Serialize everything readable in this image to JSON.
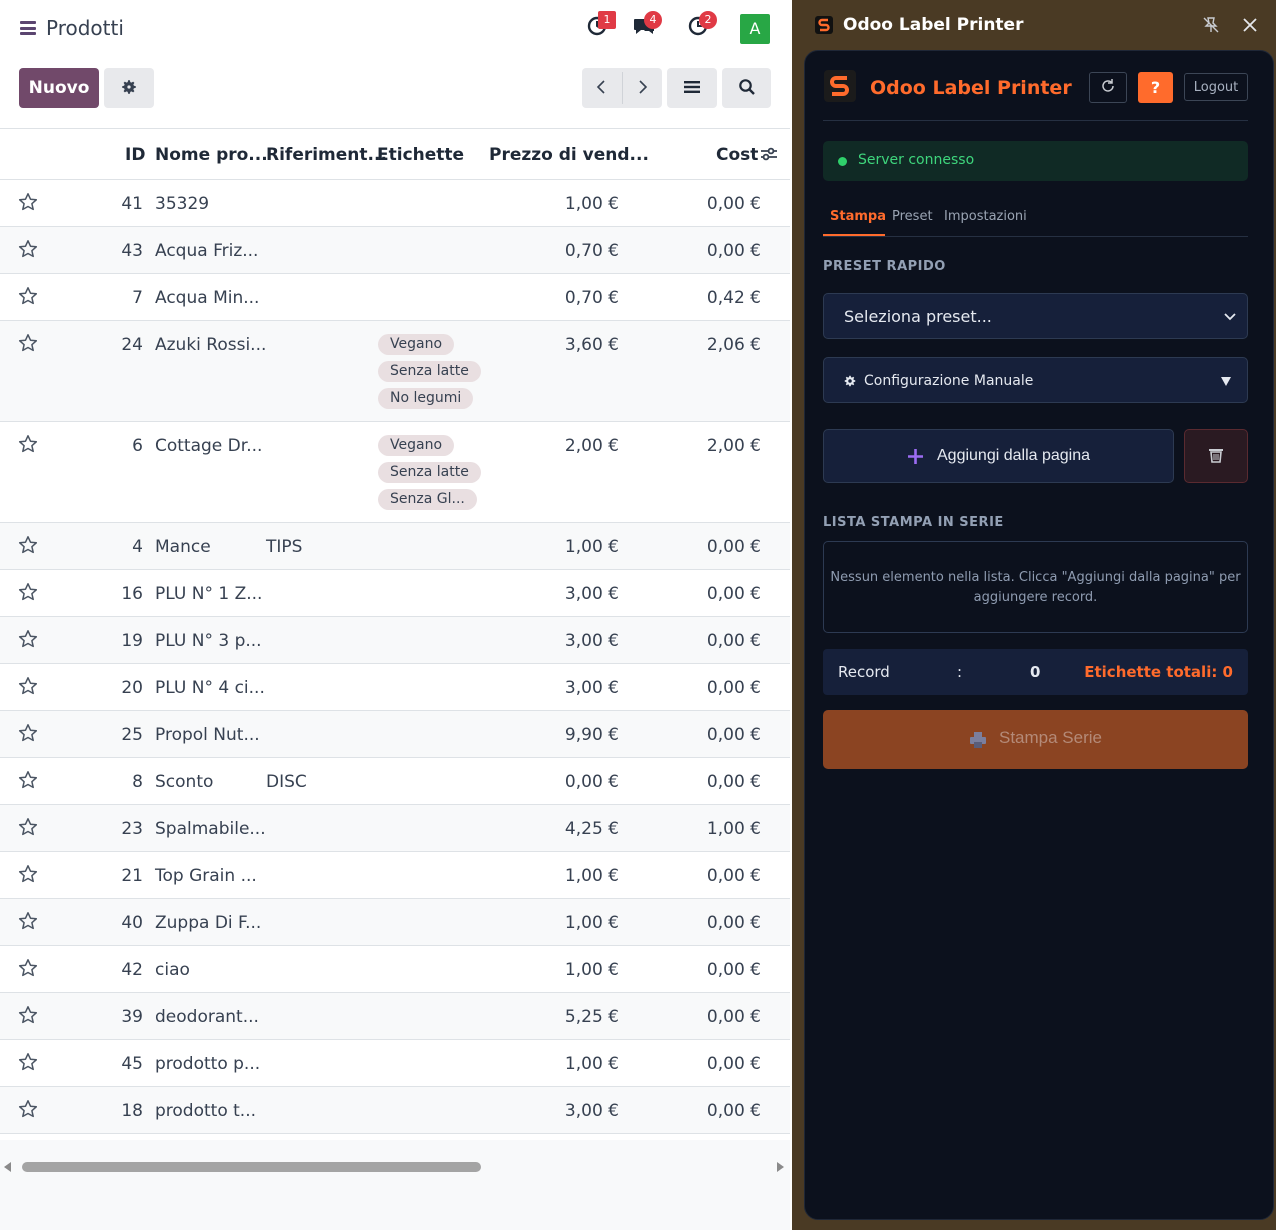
{
  "odoo": {
    "title": "Prodotti",
    "notifications": {
      "activity_count": "1",
      "messages_count": "4",
      "clock_count": "2"
    },
    "avatar_letter": "A",
    "toolbar": {
      "new_label": "Nuovo"
    },
    "columns": {
      "id": "ID",
      "name": "Nome pro...",
      "ref": "Riferiment...",
      "tags": "Etichette",
      "price": "Prezzo di vend...",
      "cost": "Cost"
    },
    "rows": [
      {
        "id": "41",
        "name": "35329",
        "ref": "",
        "tags": [],
        "price": "1,00 €",
        "cost": "0,00 €"
      },
      {
        "id": "43",
        "name": "Acqua Friz...",
        "ref": "",
        "tags": [],
        "price": "0,70 €",
        "cost": "0,00 €"
      },
      {
        "id": "7",
        "name": "Acqua Min...",
        "ref": "",
        "tags": [],
        "price": "0,70 €",
        "cost": "0,42 €"
      },
      {
        "id": "24",
        "name": "Azuki Rossi...",
        "ref": "",
        "tags": [
          "Vegano",
          "Senza latte",
          "No legumi"
        ],
        "price": "3,60 €",
        "cost": "2,06 €"
      },
      {
        "id": "6",
        "name": "Cottage Dr...",
        "ref": "",
        "tags": [
          "Vegano",
          "Senza latte",
          "Senza Gl..."
        ],
        "price": "2,00 €",
        "cost": "2,00 €"
      },
      {
        "id": "4",
        "name": "Mance",
        "ref": "TIPS",
        "tags": [],
        "price": "1,00 €",
        "cost": "0,00 €"
      },
      {
        "id": "16",
        "name": "PLU N° 1 Z...",
        "ref": "",
        "tags": [],
        "price": "3,00 €",
        "cost": "0,00 €"
      },
      {
        "id": "19",
        "name": "PLU N° 3 p...",
        "ref": "",
        "tags": [],
        "price": "3,00 €",
        "cost": "0,00 €"
      },
      {
        "id": "20",
        "name": "PLU N° 4 ci...",
        "ref": "",
        "tags": [],
        "price": "3,00 €",
        "cost": "0,00 €"
      },
      {
        "id": "25",
        "name": "Propol Nut...",
        "ref": "",
        "tags": [],
        "price": "9,90 €",
        "cost": "0,00 €"
      },
      {
        "id": "8",
        "name": "Sconto",
        "ref": "DISC",
        "tags": [],
        "price": "0,00 €",
        "cost": "0,00 €"
      },
      {
        "id": "23",
        "name": "Spalmabile...",
        "ref": "",
        "tags": [],
        "price": "4,25 €",
        "cost": "1,00 €"
      },
      {
        "id": "21",
        "name": "Top Grain ...",
        "ref": "",
        "tags": [],
        "price": "1,00 €",
        "cost": "0,00 €"
      },
      {
        "id": "40",
        "name": "Zuppa Di F...",
        "ref": "",
        "tags": [],
        "price": "1,00 €",
        "cost": "0,00 €"
      },
      {
        "id": "42",
        "name": "ciao",
        "ref": "",
        "tags": [],
        "price": "1,00 €",
        "cost": "0,00 €"
      },
      {
        "id": "39",
        "name": "deodorant...",
        "ref": "",
        "tags": [],
        "price": "5,25 €",
        "cost": "0,00 €"
      },
      {
        "id": "45",
        "name": "prodotto p...",
        "ref": "",
        "tags": [],
        "price": "1,00 €",
        "cost": "0,00 €"
      },
      {
        "id": "18",
        "name": "prodotto t...",
        "ref": "",
        "tags": [],
        "price": "3,00 €",
        "cost": "0,00 €"
      }
    ],
    "icons": [
      "menu-icon",
      "activity-icon",
      "chat-icon",
      "clock-icon",
      "gear-icon",
      "chevron-left-icon",
      "chevron-right-icon",
      "list-view-icon",
      "search-icon",
      "star-icon",
      "column-settings-icon"
    ]
  },
  "extension": {
    "window_title": "Odoo Label Printer",
    "header_title": "Odoo Label Printer",
    "help_label": "?",
    "logout_label": "Logout",
    "status_text": "Server connesso",
    "tabs": [
      "Stampa",
      "Preset",
      "Impostazioni"
    ],
    "quick_preset_label": "PRESET RAPIDO",
    "preset_select_value": "Seleziona preset...",
    "manual_config_label": "Configurazione Manuale",
    "add_from_page_label": "Aggiungi dalla pagina",
    "batch_list_label": "LISTA STAMPA IN SERIE",
    "empty_list_text": "Nessun elemento nella lista. Clicca \"Aggiungi dalla pagina\" per aggiungere record.",
    "record_label": "Record",
    "record_colon": ":",
    "record_count": "0",
    "total_labels": "Etichette totali: 0",
    "print_button_label": "Stampa Serie",
    "colors": {
      "accent": "#ff6b2c",
      "status_green": "#3ed57c",
      "panel_bg": "#0c111d",
      "print_button": "#8b4422"
    },
    "icons": [
      "app-logo-icon",
      "pin-icon",
      "close-icon",
      "refresh-icon",
      "chevron-down-icon",
      "gear-icon",
      "plus-icon",
      "trash-icon",
      "printer-icon"
    ]
  }
}
